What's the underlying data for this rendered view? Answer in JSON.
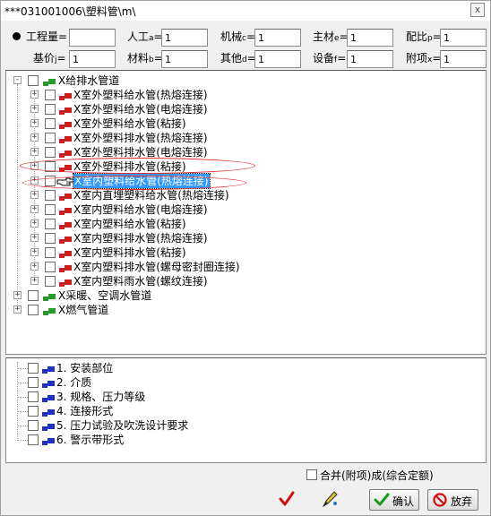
{
  "window": {
    "title": "***031001006\\塑料管\\m\\",
    "close_label": "x"
  },
  "header_fields": {
    "quantity": {
      "label": "工程量=",
      "value": ""
    },
    "labor": {
      "label": "人工",
      "sub": "a",
      "value": "1"
    },
    "machine": {
      "label": "机械",
      "sub": "c",
      "value": "1"
    },
    "main_material": {
      "label": "主材",
      "sub": "e",
      "value": "1"
    },
    "ratio": {
      "label": "配比",
      "sub": "p",
      "value": "1"
    },
    "base_price": {
      "label": "基价",
      "sub": "j",
      "value": "1"
    },
    "material": {
      "label": "材料",
      "sub": "b",
      "value": "1"
    },
    "other": {
      "label": "其他",
      "sub": "d",
      "value": "1"
    },
    "equipment": {
      "label": "设备",
      "sub": "f",
      "value": "1"
    },
    "extra_item": {
      "label": "附项",
      "sub": "x",
      "value": "1"
    }
  },
  "tree": {
    "groups": [
      {
        "label": "X给排水管道",
        "expander": "-"
      },
      {
        "label": "X采暖、空调水管道",
        "expander": "+"
      },
      {
        "label": "X燃气管道",
        "expander": "+"
      }
    ],
    "children": [
      "X室外塑料给水管(热熔连接)",
      "X室外塑料给水管(电熔连接)",
      "X室外塑料给水管(粘接)",
      "X室外塑料排水管(热熔连接)",
      "X室外塑料排水管(电熔连接)",
      "X室外塑料排水管(粘接)",
      "X室内塑料给水管(热熔连接)",
      "X室内直埋塑料给水管(热熔连接)",
      "X室内塑料给水管(电熔连接)",
      "X室内塑料给水管(粘接)",
      "X室内塑料排水管(热熔连接)",
      "X室内塑料排水管(粘接)",
      "X室内塑料排水管(螺母密封圈连接)",
      "X室内塑料雨水管(螺纹连接)"
    ]
  },
  "attributes": [
    "1. 安装部位",
    "2. 介质",
    "3. 规格、压力等级",
    "4. 连接形式",
    "5. 压力试验及吹洗设计要求",
    "6. 警示带形式"
  ],
  "footer": {
    "merge_label": "合并(附项)成(综合定额)",
    "confirm_label": "确认",
    "cancel_label": "放弃"
  },
  "colors": {
    "selection": "#3399ff",
    "annotation": "#e03030",
    "item_icon": "#cc2020",
    "group_icon": "#2a9a2a",
    "attr_icon": "#2030c0"
  }
}
